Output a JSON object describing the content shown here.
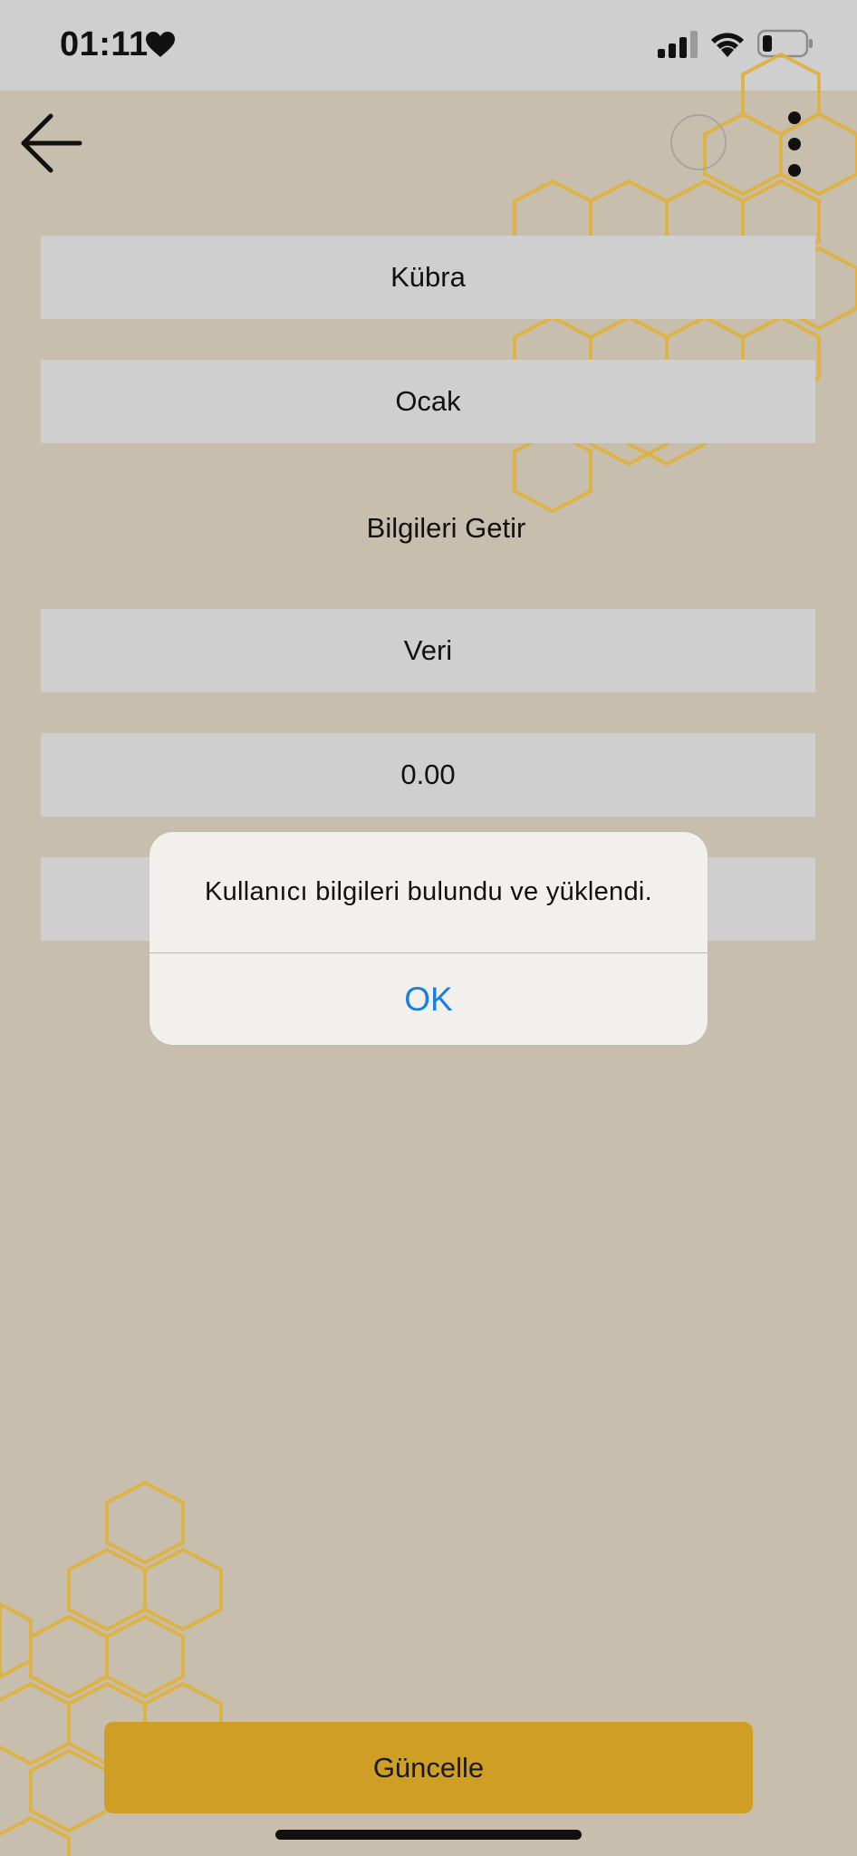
{
  "status_bar": {
    "time": "01:11",
    "heart_icon": "heart-icon",
    "signal_icon": "cellular-signal-icon",
    "wifi_icon": "wifi-icon",
    "battery_icon": "battery-low-icon"
  },
  "toolbar": {
    "back_icon": "arrow-left-icon",
    "more_icon": "vertical-dots-icon"
  },
  "form": {
    "name_value": "Kübra",
    "month_value": "Ocak",
    "fetch_label": "Bilgileri Getir",
    "data_value": "Veri",
    "amount_value": "0.00",
    "extra_value": ""
  },
  "alert": {
    "message": "Kullanıcı bilgileri bulundu ve yüklendi.",
    "ok_label": "OK"
  },
  "footer": {
    "update_label": "Güncelle"
  },
  "colors": {
    "background": "#c7beae",
    "field": "#cfcfcf",
    "accent": "#cf9f25",
    "honeycomb": "#e0b23c",
    "alert_button": "#1a7fe0"
  }
}
